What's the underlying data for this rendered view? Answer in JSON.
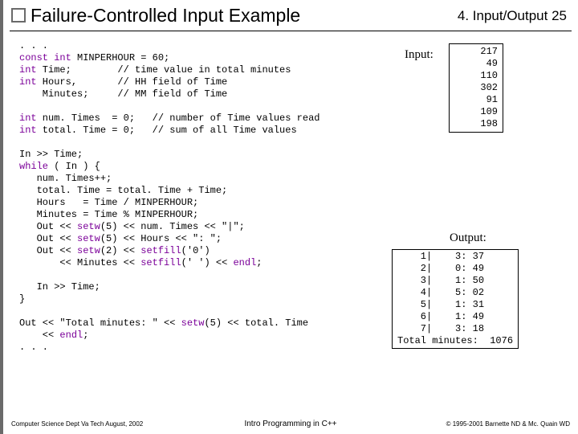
{
  "header": {
    "title": "Failure-Controlled Input Example",
    "section": "4. Input/Output  25"
  },
  "code": {
    "l1": ". . .",
    "l2a": "const int",
    "l2b": " MINPERHOUR = 60;",
    "l3a": "int",
    "l3b": " Time;        // time value in total minutes",
    "l4a": "int",
    "l4b": " Hours,       // HH field of Time",
    "l5": "    Minutes;     // MM field of Time",
    "l6": "",
    "l7a": "int",
    "l7b": " num. Times  = 0;   // number of Time values read",
    "l8a": "int",
    "l8b": " total. Time = 0;   // sum of all Time values",
    "l9": "",
    "l10": "In >> Time;",
    "l11a": "while",
    "l11b": " ( In ) {",
    "l12": "   num. Times++;",
    "l13": "   total. Time = total. Time + Time;",
    "l14": "   Hours   = Time / MINPERHOUR;",
    "l15": "   Minutes = Time % MINPERHOUR;",
    "l16a": "   Out << ",
    "l16b": "setw",
    "l16c": "(5) << num. Times << \"|\";",
    "l17a": "   Out << ",
    "l17b": "setw",
    "l17c": "(5) << Hours << \": \";",
    "l18a": "   Out << ",
    "l18b": "setw",
    "l18c": "(2) << ",
    "l18d": "setfill",
    "l18e": "('0')",
    "l19a": "       << Minutes << ",
    "l19b": "setfill",
    "l19c": "(' ') << ",
    "l19d": "endl",
    "l19e": ";",
    "l20": "",
    "l21": "   In >> Time;",
    "l22": "}",
    "l23": "",
    "l24a": "Out << \"Total minutes: \" << ",
    "l24b": "setw",
    "l24c": "(5) << total. Time",
    "l25a": "    << ",
    "l25b": "endl",
    "l25c": ";",
    "l26": ". . ."
  },
  "input_label": "Input:",
  "input_box": " 217\n  49\n 110\n 302\n  91\n 109\n 198",
  "output_label": "Output:",
  "output_box": "    1|    3: 37\n    2|    0: 49\n    3|    1: 50\n    4|    5: 02\n    5|    1: 31\n    6|    1: 49\n    7|    3: 18\nTotal minutes:  1076",
  "footer": {
    "left": "Computer Science Dept Va Tech  August, 2002",
    "mid": "Intro Programming in C++",
    "right": "© 1995-2001  Barnette ND & Mc. Quain WD"
  },
  "chart_data": {
    "type": "table",
    "title": "Input values and resulting output rows",
    "input_values": [
      217,
      49,
      110,
      302,
      91,
      109,
      198
    ],
    "output_rows": [
      {
        "index": 1,
        "hours": 3,
        "minutes": 37
      },
      {
        "index": 2,
        "hours": 0,
        "minutes": 49
      },
      {
        "index": 3,
        "hours": 1,
        "minutes": 50
      },
      {
        "index": 4,
        "hours": 5,
        "minutes": 2
      },
      {
        "index": 5,
        "hours": 1,
        "minutes": 31
      },
      {
        "index": 6,
        "hours": 1,
        "minutes": 49
      },
      {
        "index": 7,
        "hours": 3,
        "minutes": 18
      }
    ],
    "total_minutes": 1076
  }
}
